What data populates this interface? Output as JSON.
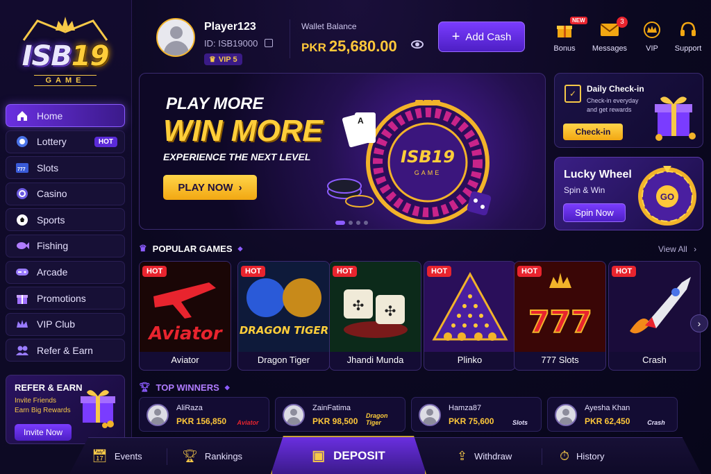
{
  "brand": {
    "logo_main": "ISB",
    "logo_num": "19",
    "logo_sub": "GAME"
  },
  "sidebar": {
    "items": [
      {
        "label": "Home",
        "icon": "home-icon"
      },
      {
        "label": "Lottery",
        "icon": "lottery-icon",
        "badge": "HOT"
      },
      {
        "label": "Slots",
        "icon": "slots-icon"
      },
      {
        "label": "Casino",
        "icon": "casino-chip-icon"
      },
      {
        "label": "Sports",
        "icon": "soccer-ball-icon"
      },
      {
        "label": "Fishing",
        "icon": "fish-icon"
      },
      {
        "label": "Arcade",
        "icon": "gamepad-icon"
      },
      {
        "label": "Promotions",
        "icon": "gift-icon"
      },
      {
        "label": "VIP Club",
        "icon": "vip-crown-icon"
      },
      {
        "label": "Refer & Earn",
        "icon": "users-icon"
      }
    ],
    "refer": {
      "title": "REFER & EARN",
      "line1": "Invite Friends",
      "line2": "Earn Big Rewards",
      "button": "Invite Now"
    }
  },
  "header": {
    "username": "Player123",
    "user_id": "ID: ISB19000",
    "vip_level": "VIP 5",
    "wallet_label": "Wallet Balance",
    "wallet_currency": "PKR",
    "wallet_amount": "25,680.00",
    "add_cash": "Add Cash",
    "actions": [
      {
        "label": "Bonus",
        "icon": "gift-icon",
        "badge": "NEW"
      },
      {
        "label": "Messages",
        "icon": "mail-icon",
        "count": "3"
      },
      {
        "label": "VIP",
        "icon": "vip-crown-icon"
      },
      {
        "label": "Support",
        "icon": "headset-icon"
      }
    ]
  },
  "hero": {
    "line1": "PLAY MORE",
    "line2": "WIN MORE",
    "line3": "EXPERIENCE THE NEXT LEVEL",
    "cta": "PLAY NOW",
    "wheel_logo": "ISB19",
    "wheel_sub": "GAME",
    "slides_total": 4,
    "slide_active": 1
  },
  "checkin": {
    "title": "Daily Check-in",
    "text": "Check-in everyday and get rewards",
    "button": "Check-in"
  },
  "lucky_wheel": {
    "title": "Lucky Wheel",
    "subtitle": "Spin & Win",
    "button": "Spin Now",
    "center": "GO"
  },
  "popular": {
    "title": "POPULAR GAMES",
    "view_all": "View All",
    "games": [
      {
        "name": "Aviator",
        "tag": "HOT",
        "art_text": "Aviator"
      },
      {
        "name": "Dragon Tiger",
        "tag": "HOT",
        "art_text": "DRAGON TIGER"
      },
      {
        "name": "Jhandi Munda",
        "tag": "HOT",
        "art_text": ""
      },
      {
        "name": "Plinko",
        "tag": "HOT",
        "art_text": ""
      },
      {
        "name": "777 Slots",
        "tag": "HOT",
        "art_text": "777"
      },
      {
        "name": "Crash",
        "tag": "HOT",
        "art_text": ""
      }
    ]
  },
  "winners": {
    "title": "TOP WINNERS",
    "list": [
      {
        "name": "AliRaza",
        "amount": "PKR 156,850",
        "game": "Aviator"
      },
      {
        "name": "ZainFatima",
        "amount": "PKR 98,500",
        "game": "Dragon Tiger"
      },
      {
        "name": "Hamza87",
        "amount": "PKR 75,600",
        "game": "Slots"
      },
      {
        "name": "Ayesha Khan",
        "amount": "PKR 62,450",
        "game": "Crash"
      }
    ]
  },
  "bottom_nav": {
    "events": "Events",
    "rankings": "Rankings",
    "deposit": "DEPOSIT",
    "withdraw": "Withdraw",
    "history": "History"
  },
  "colors": {
    "accent": "#6a2fe0",
    "gold": "#ffc83a",
    "hot": "#e8242e"
  }
}
